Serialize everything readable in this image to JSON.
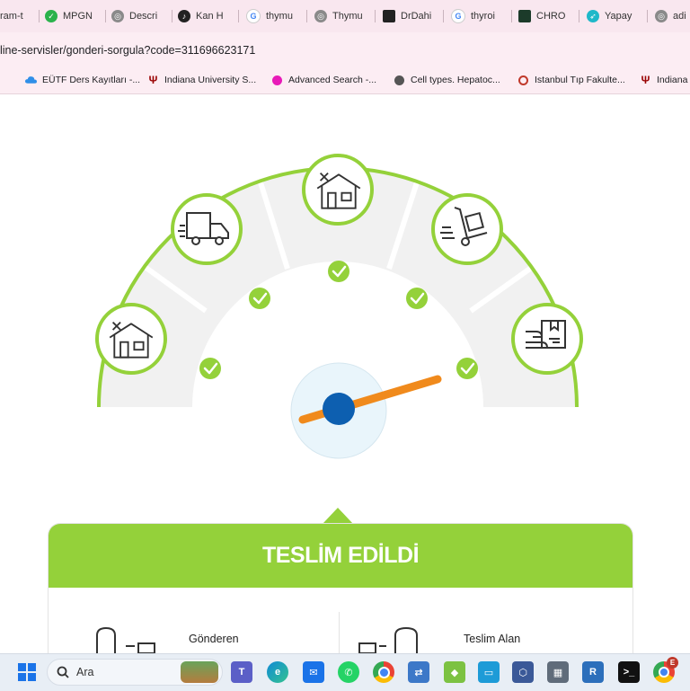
{
  "browser": {
    "tabs": [
      {
        "label": "ram-t",
        "icon": "generic-tab-icon"
      },
      {
        "label": "MPGN",
        "icon": "green-circle-icon"
      },
      {
        "label": "Descri",
        "icon": "globe-icon"
      },
      {
        "label": "Kan H",
        "icon": "tiktok-icon"
      },
      {
        "label": "thymu",
        "icon": "google-icon"
      },
      {
        "label": "Thymu",
        "icon": "globe-icon"
      },
      {
        "label": "DrDahi",
        "icon": "dark-square-icon"
      },
      {
        "label": "thyroi",
        "icon": "google-icon"
      },
      {
        "label": "CHRO",
        "icon": "chron-icon"
      },
      {
        "label": "Yapay",
        "icon": "bird-icon"
      },
      {
        "label": "adi",
        "icon": "globe-icon"
      }
    ],
    "url": "line-servisler/gonderi-sorgula?code=311696623171",
    "bookmarks": [
      {
        "label": "EÜTF Ders Kayıtları -...",
        "icon": "cloud-icon"
      },
      {
        "label": "Indiana University S...",
        "icon": "iu-logo-icon"
      },
      {
        "label": "Advanced Search -...",
        "icon": "magenta-dot-icon"
      },
      {
        "label": "Cell types. Hepatoc...",
        "icon": "globe-icon"
      },
      {
        "label": "Istanbul Tıp Fakulte...",
        "icon": "seal-icon"
      },
      {
        "label": "Indiana",
        "icon": "iu-logo-icon"
      }
    ]
  },
  "tracker": {
    "status": "TESLİM EDİLDİ",
    "steps": [
      {
        "name": "origin-warehouse",
        "icon": "warehouse-icon",
        "done": true
      },
      {
        "name": "in-transit",
        "icon": "truck-icon",
        "done": true
      },
      {
        "name": "distribution-center",
        "icon": "warehouse-icon",
        "done": true
      },
      {
        "name": "out-for-delivery",
        "icon": "hand-truck-icon",
        "done": true
      },
      {
        "name": "delivered",
        "icon": "package-handover-icon",
        "done": true
      }
    ],
    "needle_position": 1.0,
    "sender_label": "Gönderen",
    "receiver_label": "Teslim Alan",
    "colors": {
      "green": "#94d13a",
      "needle": "#f08a1c",
      "hub": "#0d5fb0",
      "track": "#f1f1f1"
    }
  },
  "taskbar": {
    "search_label": "Ara",
    "apps": [
      "start-icon",
      "search-icon",
      "widgets-icon",
      "teams-icon",
      "edge-icon",
      "mail-icon",
      "whatsapp-icon",
      "chrome-icon",
      "network-icon",
      "android-icon",
      "monitor-icon",
      "virtualbox-icon",
      "calculator-icon",
      "r-icon",
      "terminal-icon",
      "chrome-profile-icon"
    ],
    "notification_badge": "E"
  }
}
